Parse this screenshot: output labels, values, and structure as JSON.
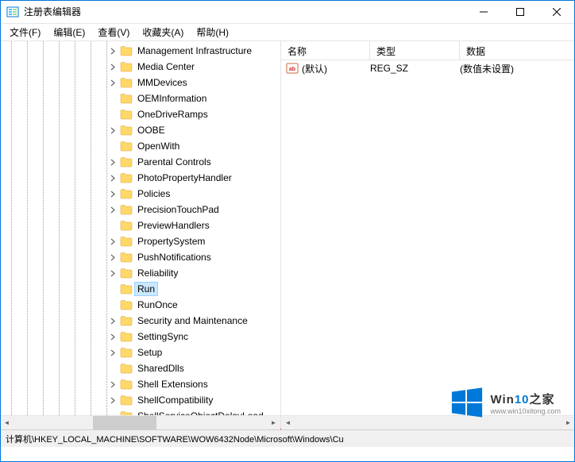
{
  "window": {
    "title": "注册表编辑器"
  },
  "menu": {
    "file": "文件(F)",
    "edit": "编辑(E)",
    "view": "查看(V)",
    "favorites": "收藏夹(A)",
    "help": "帮助(H)"
  },
  "tree": {
    "items": [
      {
        "label": "Management Infrastructure",
        "expandable": true
      },
      {
        "label": "Media Center",
        "expandable": true
      },
      {
        "label": "MMDevices",
        "expandable": true
      },
      {
        "label": "OEMInformation",
        "expandable": false
      },
      {
        "label": "OneDriveRamps",
        "expandable": false
      },
      {
        "label": "OOBE",
        "expandable": true
      },
      {
        "label": "OpenWith",
        "expandable": false
      },
      {
        "label": "Parental Controls",
        "expandable": true
      },
      {
        "label": "PhotoPropertyHandler",
        "expandable": true
      },
      {
        "label": "Policies",
        "expandable": true
      },
      {
        "label": "PrecisionTouchPad",
        "expandable": true
      },
      {
        "label": "PreviewHandlers",
        "expandable": false
      },
      {
        "label": "PropertySystem",
        "expandable": true
      },
      {
        "label": "PushNotifications",
        "expandable": true
      },
      {
        "label": "Reliability",
        "expandable": true
      },
      {
        "label": "Run",
        "expandable": false,
        "selected": true
      },
      {
        "label": "RunOnce",
        "expandable": false
      },
      {
        "label": "Security and Maintenance",
        "expandable": true
      },
      {
        "label": "SettingSync",
        "expandable": true
      },
      {
        "label": "Setup",
        "expandable": true
      },
      {
        "label": "SharedDlls",
        "expandable": false
      },
      {
        "label": "Shell Extensions",
        "expandable": true
      },
      {
        "label": "ShellCompatibility",
        "expandable": true
      },
      {
        "label": "ShellServiceObjectDelayLoad",
        "expandable": false
      }
    ]
  },
  "list": {
    "columns": {
      "name": "名称",
      "type": "类型",
      "data": "数据"
    },
    "rows": [
      {
        "name": "(默认)",
        "type": "REG_SZ",
        "data": "(数值未设置)"
      }
    ]
  },
  "statusbar": {
    "path": "计算机\\HKEY_LOCAL_MACHINE\\SOFTWARE\\WOW6432Node\\Microsoft\\Windows\\Cu"
  },
  "watermark": {
    "brand_prefix": "Win",
    "brand_accent": "10",
    "brand_suffix": "之家",
    "url": "www.win10xitong.com"
  }
}
